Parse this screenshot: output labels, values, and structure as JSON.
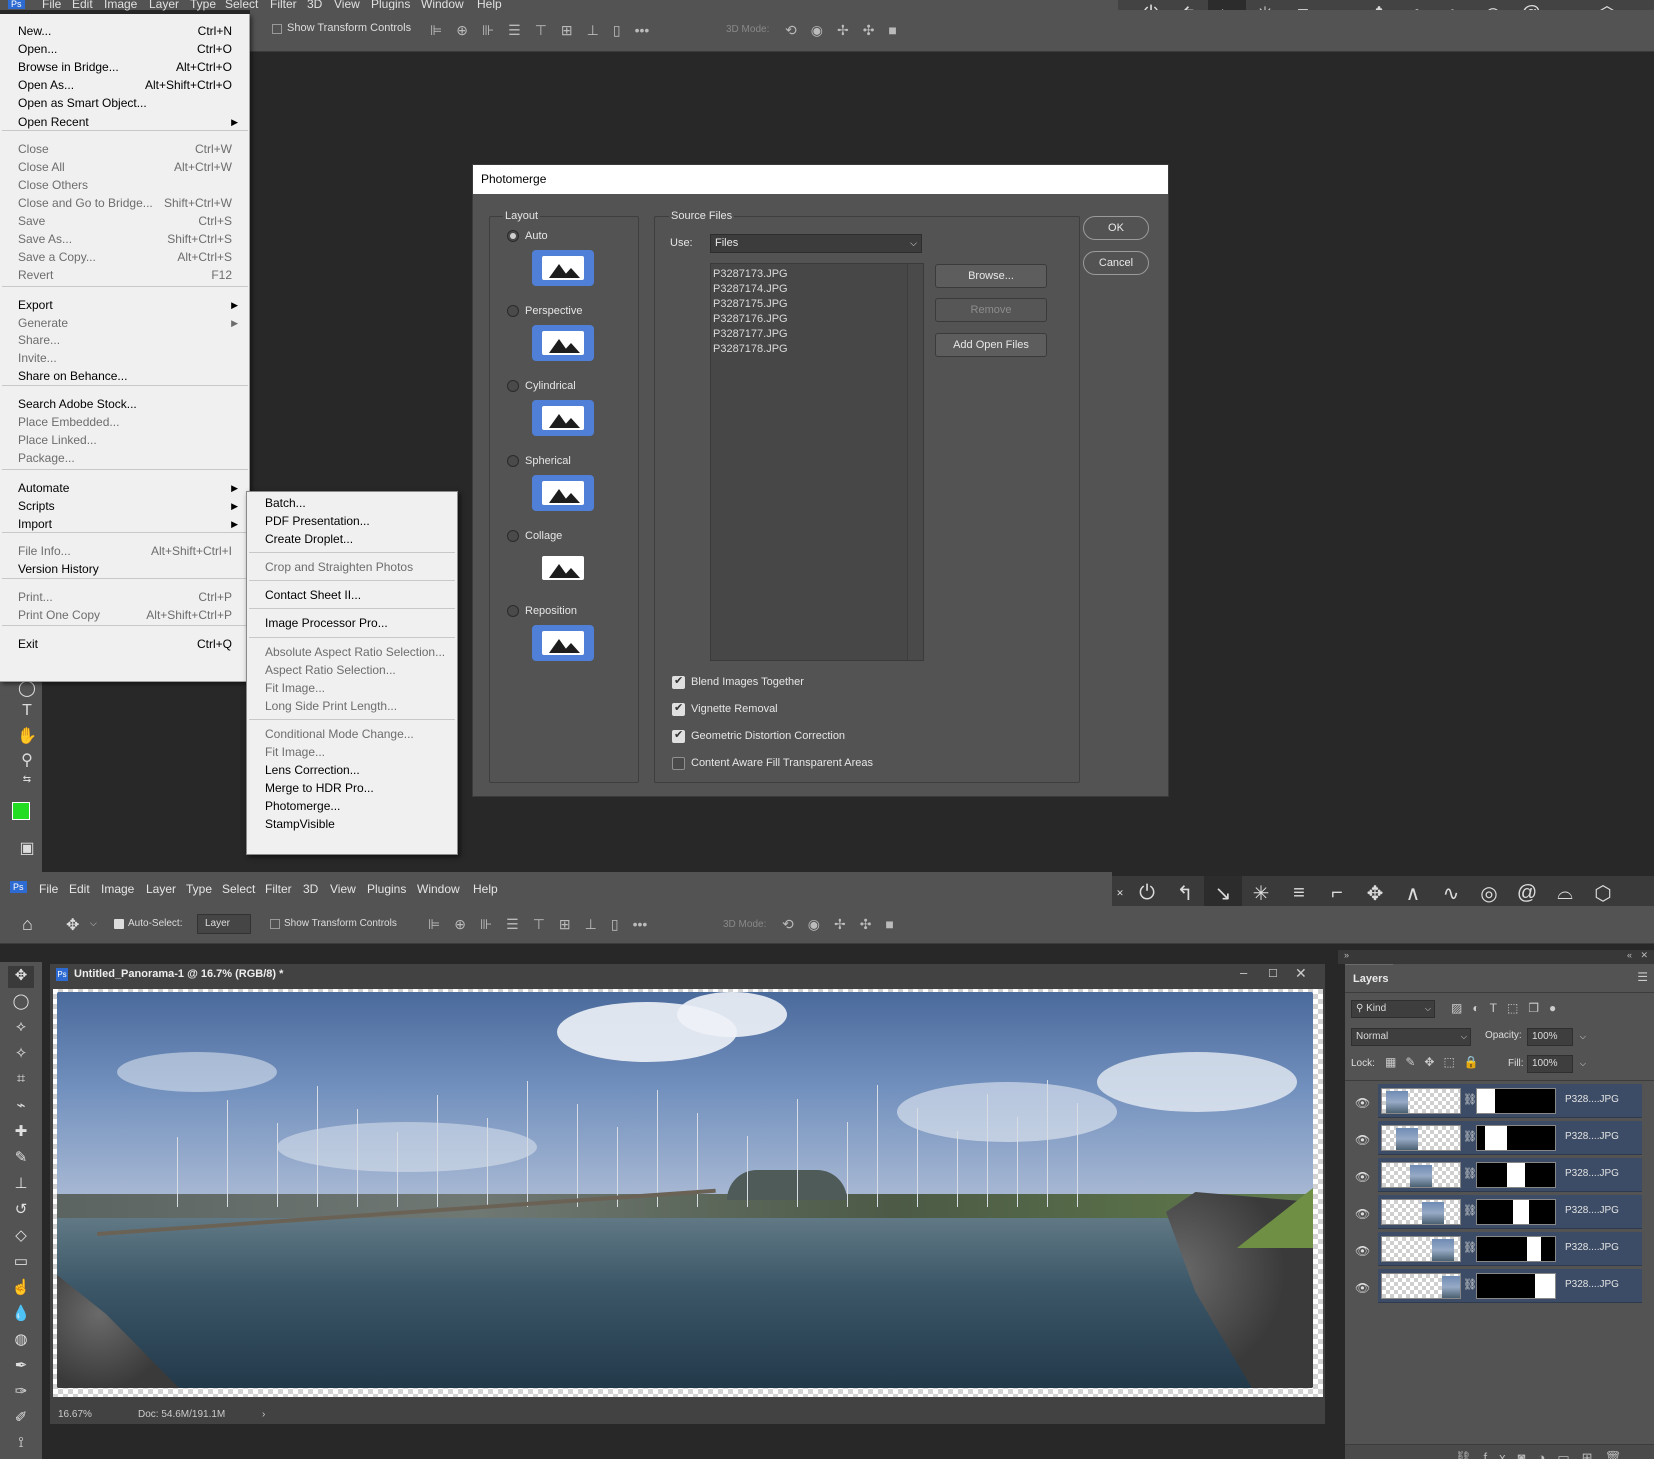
{
  "top": {
    "menubar": [
      "File",
      "Edit",
      "Image",
      "Layer",
      "Type",
      "Select",
      "Filter",
      "3D",
      "View",
      "Plugins",
      "Window",
      "Help"
    ],
    "show_transform_label": "Show Transform Controls",
    "three_d_mode_label": "3D Mode:",
    "file_menu": {
      "items": [
        {
          "label": "New...",
          "shortcut": "Ctrl+N",
          "disabled": false
        },
        {
          "label": "Open...",
          "shortcut": "Ctrl+O",
          "disabled": false
        },
        {
          "label": "Browse in Bridge...",
          "shortcut": "Alt+Ctrl+O",
          "disabled": false
        },
        {
          "label": "Open As...",
          "shortcut": "Alt+Shift+Ctrl+O",
          "disabled": false
        },
        {
          "label": "Open as Smart Object...",
          "shortcut": "",
          "disabled": false
        },
        {
          "label": "Open Recent",
          "shortcut": "",
          "disabled": false,
          "submenu": true
        },
        {
          "label": "Close",
          "shortcut": "Ctrl+W",
          "disabled": true
        },
        {
          "label": "Close All",
          "shortcut": "Alt+Ctrl+W",
          "disabled": true
        },
        {
          "label": "Close Others",
          "shortcut": "",
          "disabled": true
        },
        {
          "label": "Close and Go to Bridge...",
          "shortcut": "Shift+Ctrl+W",
          "disabled": true
        },
        {
          "label": "Save",
          "shortcut": "Ctrl+S",
          "disabled": true
        },
        {
          "label": "Save As...",
          "shortcut": "Shift+Ctrl+S",
          "disabled": true
        },
        {
          "label": "Save a Copy...",
          "shortcut": "Alt+Ctrl+S",
          "disabled": true
        },
        {
          "label": "Revert",
          "shortcut": "F12",
          "disabled": true
        },
        {
          "label": "Export",
          "shortcut": "",
          "disabled": false,
          "submenu": true
        },
        {
          "label": "Generate",
          "shortcut": "",
          "disabled": true,
          "submenu": true
        },
        {
          "label": "Share...",
          "shortcut": "",
          "disabled": true
        },
        {
          "label": "Invite...",
          "shortcut": "",
          "disabled": true
        },
        {
          "label": "Share on Behance...",
          "shortcut": "",
          "disabled": false
        },
        {
          "label": "Search Adobe Stock...",
          "shortcut": "",
          "disabled": false
        },
        {
          "label": "Place Embedded...",
          "shortcut": "",
          "disabled": true
        },
        {
          "label": "Place Linked...",
          "shortcut": "",
          "disabled": true
        },
        {
          "label": "Package...",
          "shortcut": "",
          "disabled": true
        },
        {
          "label": "Automate",
          "shortcut": "",
          "disabled": false,
          "submenu": true
        },
        {
          "label": "Scripts",
          "shortcut": "",
          "disabled": false,
          "submenu": true
        },
        {
          "label": "Import",
          "shortcut": "",
          "disabled": false,
          "submenu": true
        },
        {
          "label": "File Info...",
          "shortcut": "Alt+Shift+Ctrl+I",
          "disabled": true
        },
        {
          "label": "Version History",
          "shortcut": "",
          "disabled": false
        },
        {
          "label": "Print...",
          "shortcut": "Ctrl+P",
          "disabled": true
        },
        {
          "label": "Print One Copy",
          "shortcut": "Alt+Shift+Ctrl+P",
          "disabled": true
        },
        {
          "label": "Exit",
          "shortcut": "Ctrl+Q",
          "disabled": false
        }
      ]
    },
    "automate_menu": {
      "items": [
        {
          "label": "Batch...",
          "disabled": false
        },
        {
          "label": "PDF Presentation...",
          "disabled": false
        },
        {
          "label": "Create Droplet...",
          "disabled": false
        },
        {
          "label": "Crop and Straighten Photos",
          "disabled": true
        },
        {
          "label": "Contact Sheet II...",
          "disabled": false
        },
        {
          "label": "Image Processor Pro...",
          "disabled": false
        },
        {
          "label": "Absolute Aspect Ratio Selection...",
          "disabled": true
        },
        {
          "label": "Aspect Ratio Selection...",
          "disabled": true
        },
        {
          "label": "Fit Image...",
          "disabled": true
        },
        {
          "label": "Long Side Print Length...",
          "disabled": true
        },
        {
          "label": "Conditional Mode Change...",
          "disabled": true
        },
        {
          "label": "Fit Image...",
          "disabled": true
        },
        {
          "label": "Lens Correction...",
          "disabled": false
        },
        {
          "label": "Merge to HDR Pro...",
          "disabled": false
        },
        {
          "label": "Photomerge...",
          "disabled": false
        },
        {
          "label": "StampVisible",
          "disabled": false
        }
      ]
    },
    "dialog": {
      "title": "Photomerge",
      "layout_label": "Layout",
      "layouts": [
        "Auto",
        "Perspective",
        "Cylindrical",
        "Spherical",
        "Collage",
        "Reposition"
      ],
      "selected_layout": "Auto",
      "source_files_label": "Source Files",
      "use_label": "Use:",
      "use_value": "Files",
      "files": [
        "P3287173.JPG",
        "P3287174.JPG",
        "P3287175.JPG",
        "P3287176.JPG",
        "P3287177.JPG",
        "P3287178.JPG"
      ],
      "browse_label": "Browse...",
      "remove_label": "Remove",
      "add_open_label": "Add Open Files",
      "ok_label": "OK",
      "cancel_label": "Cancel",
      "options": [
        {
          "label": "Blend Images Together",
          "checked": true
        },
        {
          "label": "Vignette Removal",
          "checked": true
        },
        {
          "label": "Geometric Distortion Correction",
          "checked": true
        },
        {
          "label": "Content Aware Fill Transparent Areas",
          "checked": false
        }
      ]
    }
  },
  "bottom": {
    "menubar": [
      "File",
      "Edit",
      "Image",
      "Layer",
      "Type",
      "Select",
      "Filter",
      "3D",
      "View",
      "Plugins",
      "Window",
      "Help"
    ],
    "auto_select_label": "Auto-Select:",
    "auto_select_value": "Layer",
    "show_transform_label": "Show Transform Controls",
    "three_d_mode_label": "3D Mode:",
    "doc_title": "Untitled_Panorama-1 @ 16.7% (RGB/8) *",
    "zoom": "16.67%",
    "doc_size": "Doc: 54.6M/191.1M",
    "layers_panel": {
      "title": "Layers",
      "kind_label": "Kind",
      "blend_mode": "Normal",
      "opacity_label": "Opacity:",
      "opacity": "100%",
      "lock_label": "Lock:",
      "fill_label": "Fill:",
      "fill": "100%",
      "layers": [
        {
          "name": "P328....JPG"
        },
        {
          "name": "P328....JPG"
        },
        {
          "name": "P328....JPG"
        },
        {
          "name": "P328....JPG"
        },
        {
          "name": "P328....JPG"
        },
        {
          "name": "P328....JPG"
        }
      ]
    }
  },
  "colors": {
    "accent": "#4f7fd6",
    "foreground_swatch": "#22dd22",
    "layer_selected": "#3c4c66"
  }
}
